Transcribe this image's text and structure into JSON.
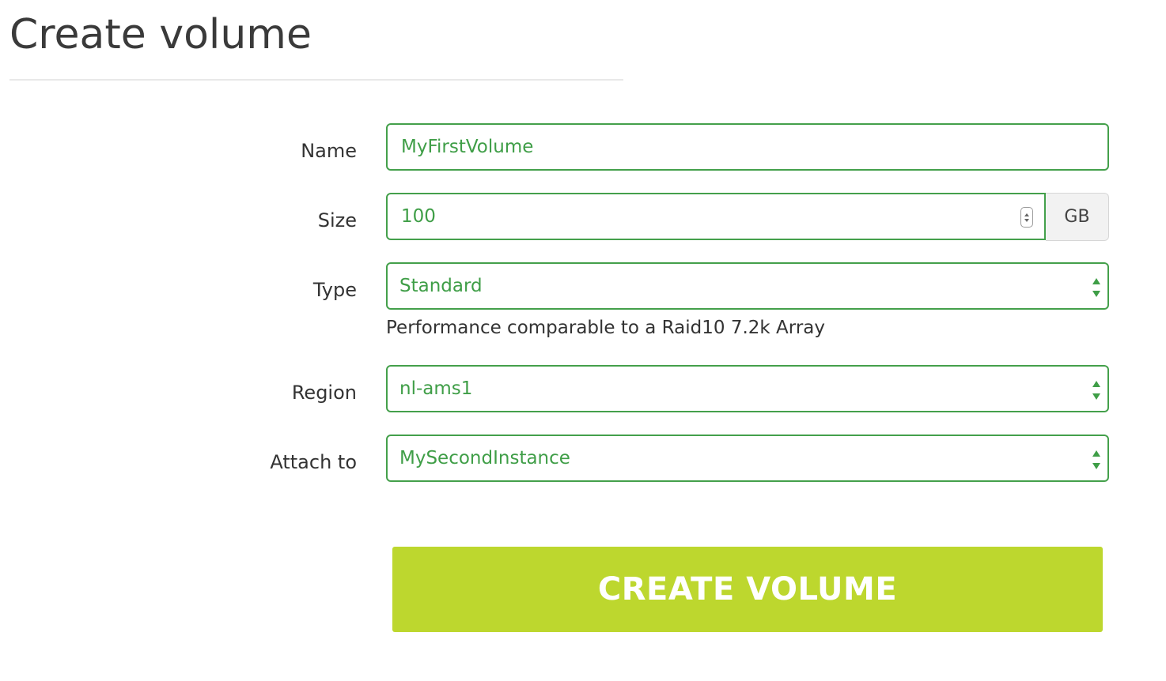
{
  "page": {
    "title": "Create volume"
  },
  "form": {
    "name": {
      "label": "Name",
      "value": "MyFirstVolume"
    },
    "size": {
      "label": "Size",
      "value": "100",
      "unit": "GB"
    },
    "type": {
      "label": "Type",
      "selected": "Standard",
      "help": "Performance comparable to a Raid10 7.2k Array"
    },
    "region": {
      "label": "Region",
      "selected": "nl-ams1"
    },
    "attach_to": {
      "label": "Attach to",
      "selected": "MySecondInstance"
    }
  },
  "actions": {
    "create_label": "CREATE VOLUME"
  },
  "colors": {
    "field_border": "#44a04b",
    "field_text": "#3f9e47",
    "button_bg": "#bdd72e",
    "button_text": "#ffffff"
  },
  "icons": {
    "number_spinner": "spinner-arrows-icon",
    "select_caret": "select-caret-icon"
  }
}
